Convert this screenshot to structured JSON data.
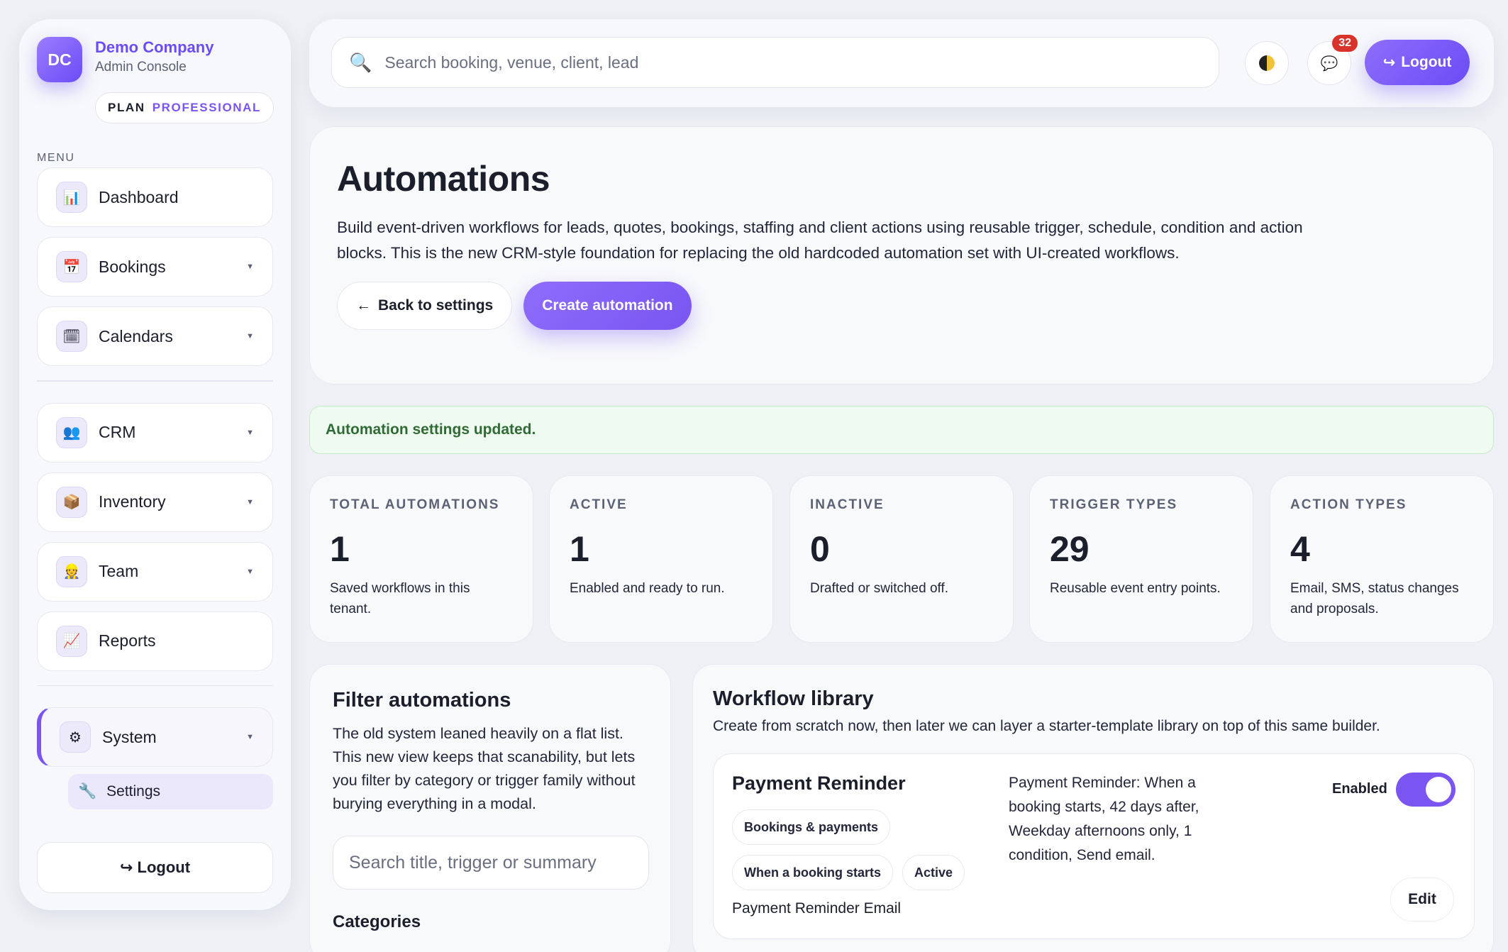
{
  "brand": {
    "initials": "DC",
    "name": "Demo Company",
    "subtitle": "Admin Console",
    "plan_label": "PLAN",
    "plan_value": "PROFESSIONAL",
    "accent": "#6b4cf6"
  },
  "sidebar": {
    "menu_title": "MENU",
    "items": [
      {
        "label": "Dashboard",
        "icon": "bar-chart-icon"
      },
      {
        "label": "Bookings",
        "icon": "calendar-icon"
      },
      {
        "label": "Calendars",
        "icon": "calendar-page-icon"
      },
      {
        "label": "CRM",
        "icon": "users-icon"
      },
      {
        "label": "Inventory",
        "icon": "package-icon"
      },
      {
        "label": "Team",
        "icon": "team-member-icon"
      },
      {
        "label": "Reports",
        "icon": "line-chart-icon"
      },
      {
        "label": "System",
        "icon": "gear-icon"
      }
    ],
    "sub_settings": "Settings",
    "logout": "Logout"
  },
  "topbar": {
    "search_placeholder": "Search booking, venue, client, lead",
    "notifications_count": "32",
    "logout": "Logout"
  },
  "hero": {
    "title": "Automations",
    "description": "Build event-driven workflows for leads, quotes, bookings, staffing and client actions using reusable trigger, schedule, condition and action blocks. This is the new CRM-style foundation for replacing the old hardcoded automation set with UI-created workflows.",
    "back_label": "Back to settings",
    "create_label": "Create automation"
  },
  "alert": {
    "message": "Automation settings updated.",
    "color": "#2f6b34"
  },
  "stats": [
    {
      "label": "TOTAL AUTOMATIONS",
      "value": "1",
      "desc": "Saved workflows in this tenant."
    },
    {
      "label": "ACTIVE",
      "value": "1",
      "desc": "Enabled and ready to run."
    },
    {
      "label": "INACTIVE",
      "value": "0",
      "desc": "Drafted or switched off."
    },
    {
      "label": "TRIGGER TYPES",
      "value": "29",
      "desc": "Reusable event entry points."
    },
    {
      "label": "ACTION TYPES",
      "value": "4",
      "desc": "Email, SMS, status changes and proposals."
    }
  ],
  "filter": {
    "title": "Filter automations",
    "description": "The old system leaned heavily on a flat list. This new view keeps that scanability, but lets you filter by category or trigger family without burying everything in a modal.",
    "search_placeholder": "Search title, trigger or summary",
    "categories_title": "Categories"
  },
  "library": {
    "title": "Workflow library",
    "subtitle": "Create from scratch now, then later we can layer a starter-template library on top of this same builder.",
    "workflow": {
      "name": "Payment Reminder",
      "tags": [
        "Bookings & payments",
        "When a booking starts",
        "Active"
      ],
      "email": "Payment Reminder Email",
      "summary": "Payment Reminder: When a booking starts, 42 days after, Weekday afternoons only, 1 condition, Send email.",
      "toggle_label": "Enabled",
      "enabled": true,
      "edit_label": "Edit"
    }
  }
}
